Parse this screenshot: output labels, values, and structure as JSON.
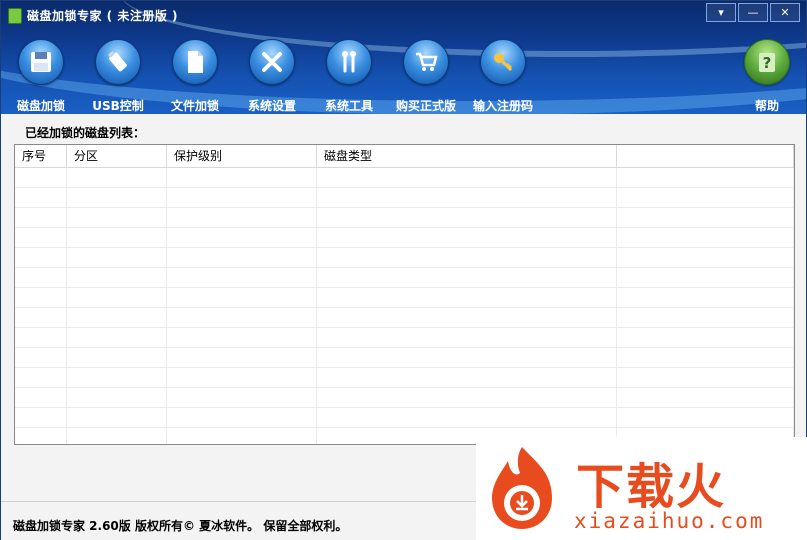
{
  "window": {
    "title": "磁盘加锁专家 ( 未注册版 )",
    "controls": {
      "menu": "▾",
      "minimize": "—",
      "close": "✕"
    }
  },
  "toolbar": {
    "items": [
      {
        "label": "磁盘加锁",
        "icon": "floppy-disk-icon"
      },
      {
        "label": "USB控制",
        "icon": "usb-drive-icon"
      },
      {
        "label": "文件加锁",
        "icon": "document-icon"
      },
      {
        "label": "系统设置",
        "icon": "tools-icon"
      },
      {
        "label": "系统工具",
        "icon": "wrench-icon"
      },
      {
        "label": "购买正式版",
        "icon": "shopping-cart-icon"
      },
      {
        "label": "输入注册码",
        "icon": "key-icon"
      },
      {
        "label": "帮助",
        "icon": "help-icon"
      }
    ]
  },
  "main": {
    "list_label": "已经加锁的磁盘列表：",
    "columns": [
      "序号",
      "分区",
      "保护级别",
      "磁盘类型",
      ""
    ]
  },
  "status": {
    "text": "磁盘加锁专家 2.60版  版权所有© 夏冰软件。 保留全部权利。"
  },
  "watermark": {
    "brand": "下载火",
    "url": "xiazaihuo.com"
  },
  "colors": {
    "header_dark": "#0a2a6b",
    "header_light": "#1a5fc4",
    "watermark": "#e84c1e"
  }
}
